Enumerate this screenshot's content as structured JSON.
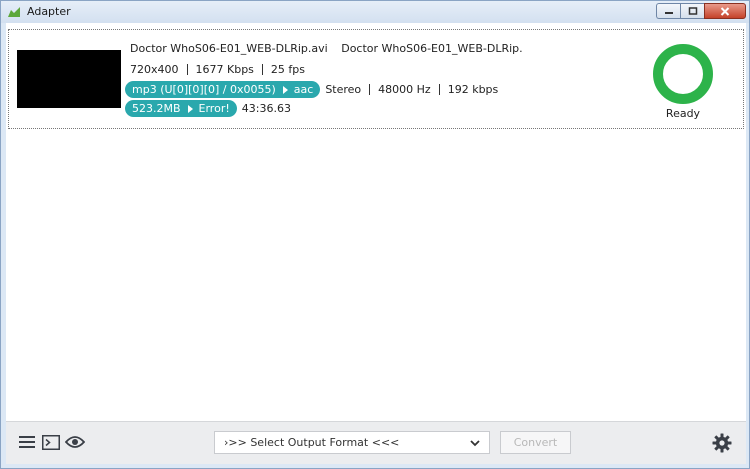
{
  "window": {
    "title": "Adapter"
  },
  "file": {
    "input_name": "Doctor WhoS06-E01_WEB-DLRip.avi",
    "output_name": "Doctor WhoS06-E01_WEB-DLRip.",
    "resolution": "720x400",
    "video_bitrate": "1677 Kbps",
    "framerate": "25 fps",
    "audio_codec_from": "mp3 (U[0][0][0] / 0x0055)",
    "audio_codec_to": "aac",
    "channels": "Stereo",
    "sample_rate": "48000 Hz",
    "audio_bitrate": "192 kbps",
    "size_from": "523.2MB",
    "size_to": "Error!",
    "duration": "43:36.63",
    "status": "Ready"
  },
  "bottom": {
    "format_select": "›>> Select Output Format <<<",
    "convert_label": "Convert"
  },
  "icons": {
    "app": "adapter-app-icon",
    "menu": "hamburger-icon",
    "log": "terminal-icon",
    "preview": "eye-icon",
    "settings": "gear-icon"
  },
  "colors": {
    "accent_teal": "#2aa8ad",
    "ready_green": "#2db34a"
  }
}
